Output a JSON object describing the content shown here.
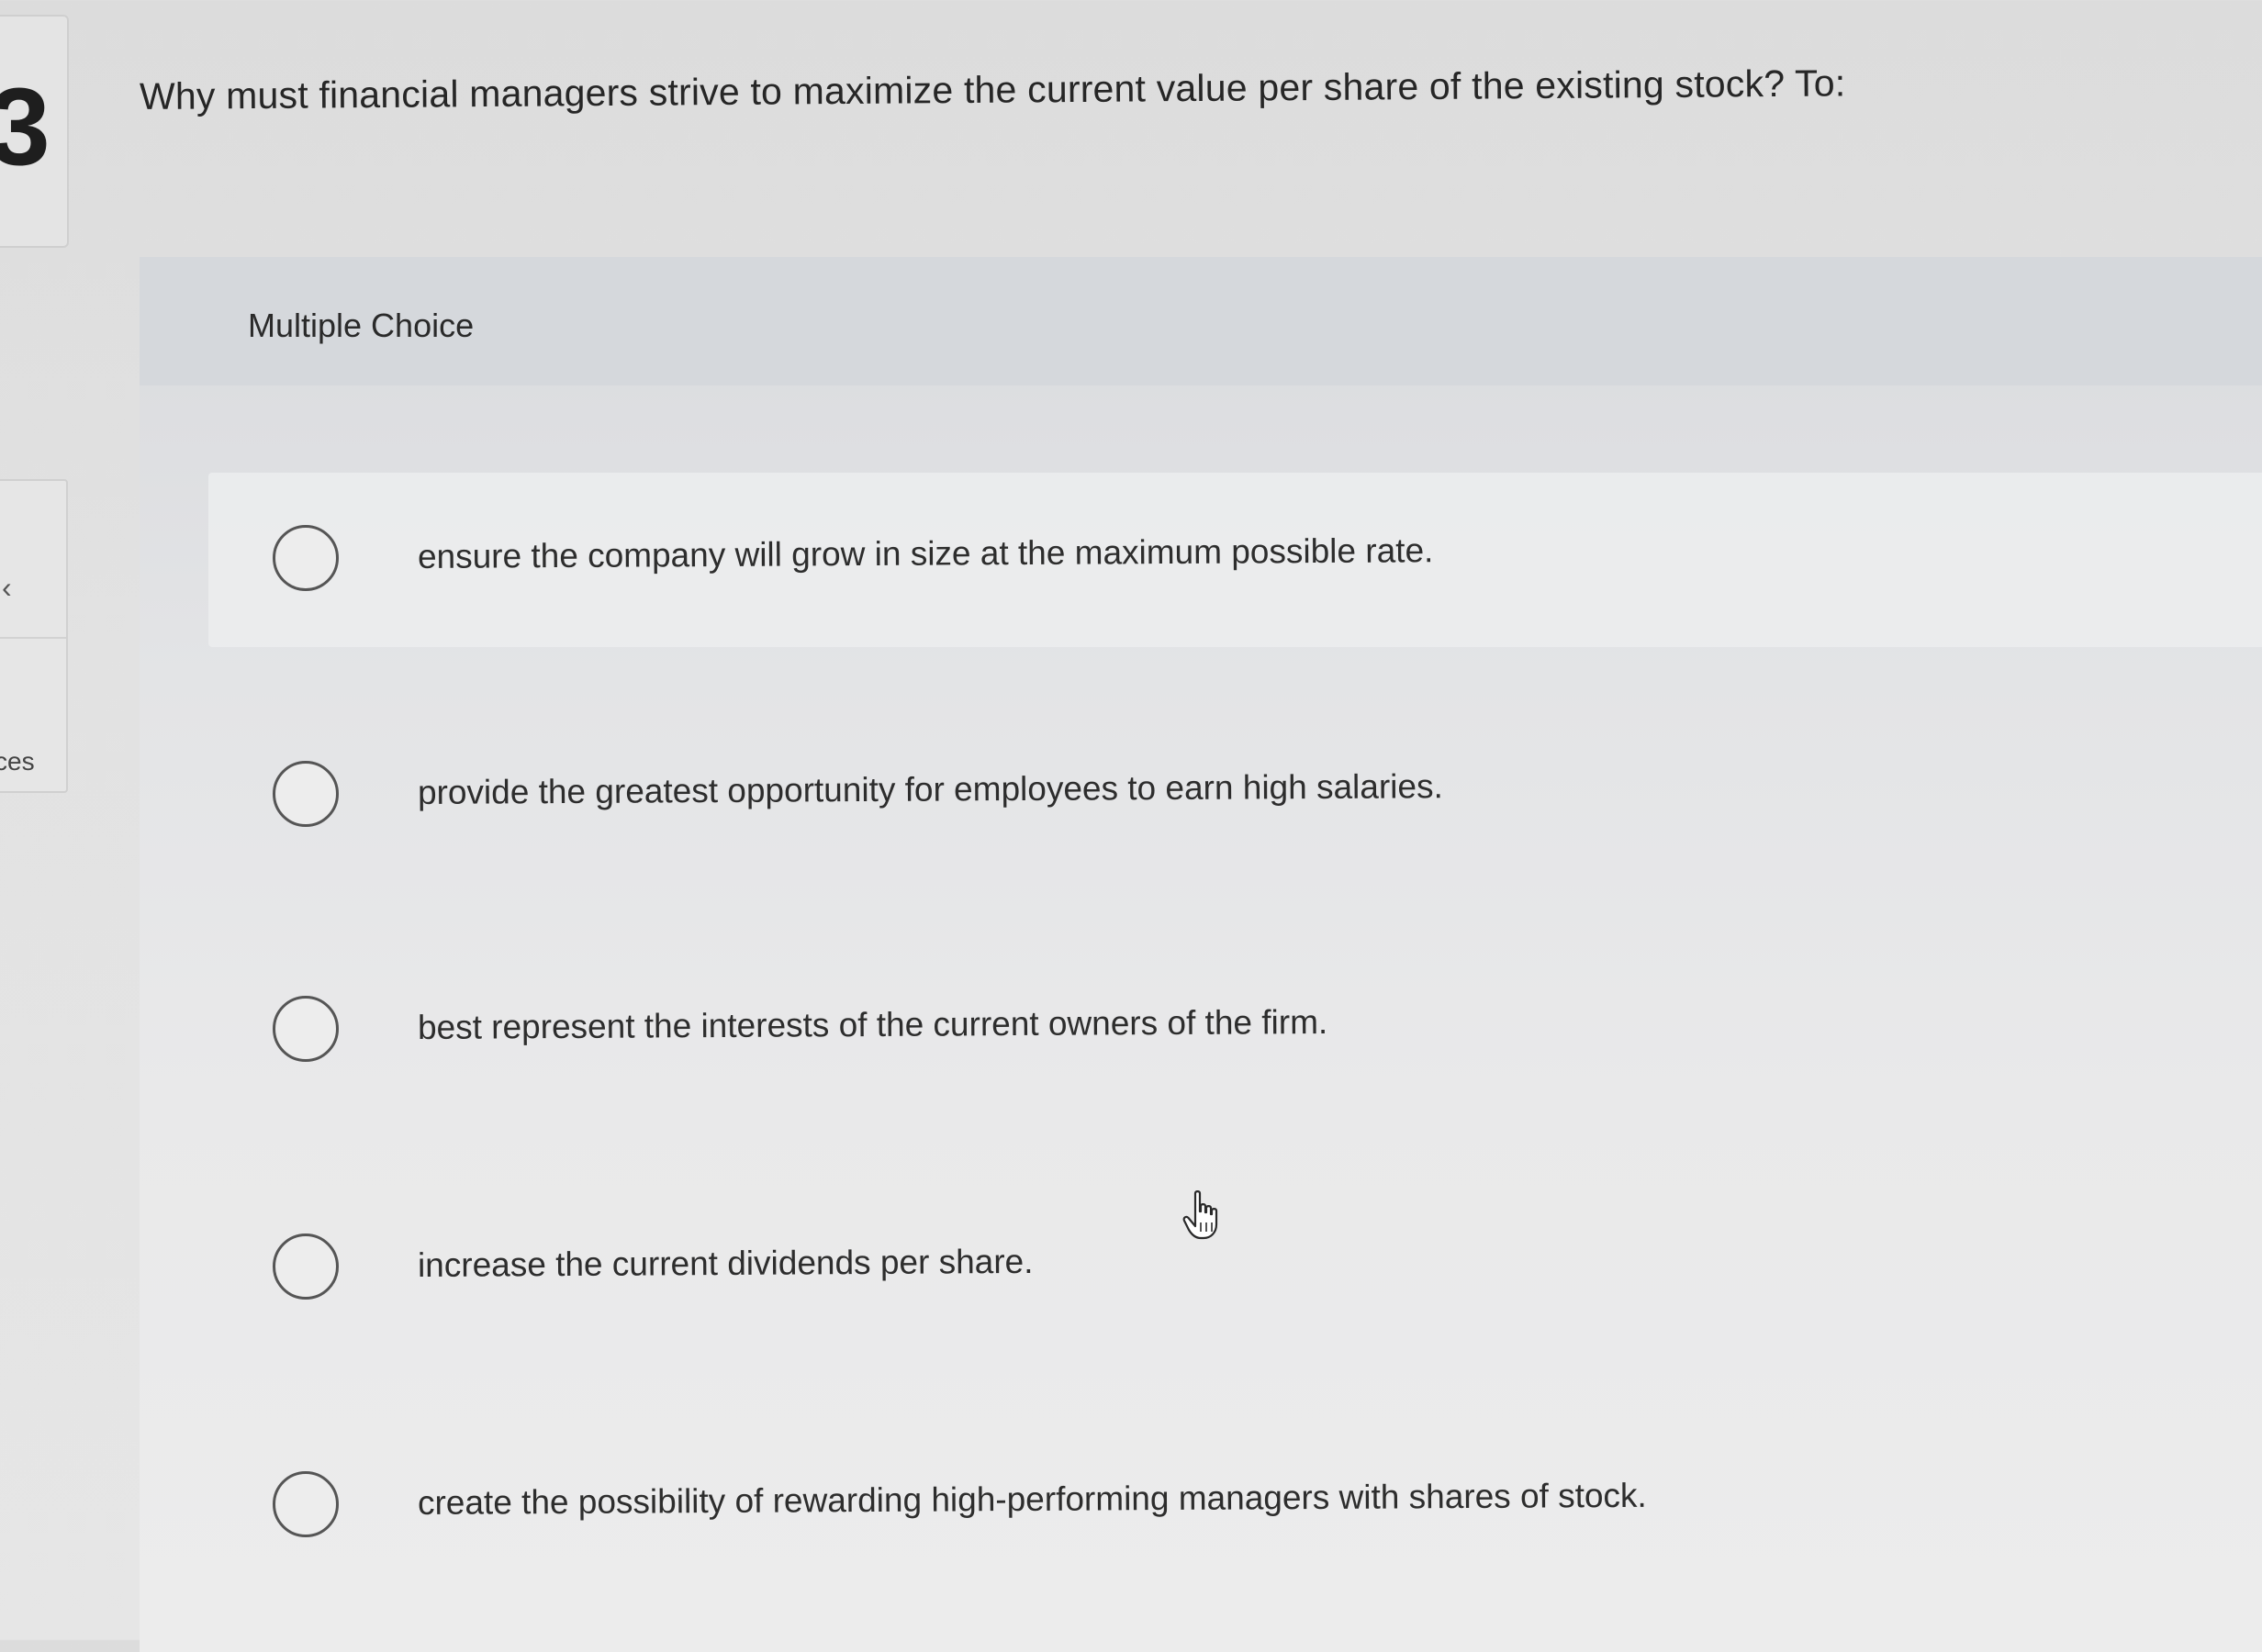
{
  "sidebar": {
    "question_number": "3",
    "collapse_glyph": "‹",
    "resources_label": "ces"
  },
  "question": {
    "text": "Why must financial managers strive to maximize the current value per share of the existing stock? To:"
  },
  "panel": {
    "header_label": "Multiple Choice",
    "options": [
      {
        "label": "ensure the company will grow in size at the maximum possible rate."
      },
      {
        "label": "provide the greatest opportunity for employees to earn high salaries."
      },
      {
        "label": "best represent the interests of the current owners of the firm."
      },
      {
        "label": "increase the current dividends per share."
      },
      {
        "label": "create the possibility of rewarding high-performing managers with shares of stock."
      }
    ]
  },
  "icons": {
    "radio": "radio-unselected-icon",
    "cursor": "hand-pointer-icon"
  },
  "colors": {
    "background": "#e2e2e2",
    "panel": "#e3e4e6",
    "panel_header": "#d5d8dc",
    "text": "#2b2b2b"
  }
}
